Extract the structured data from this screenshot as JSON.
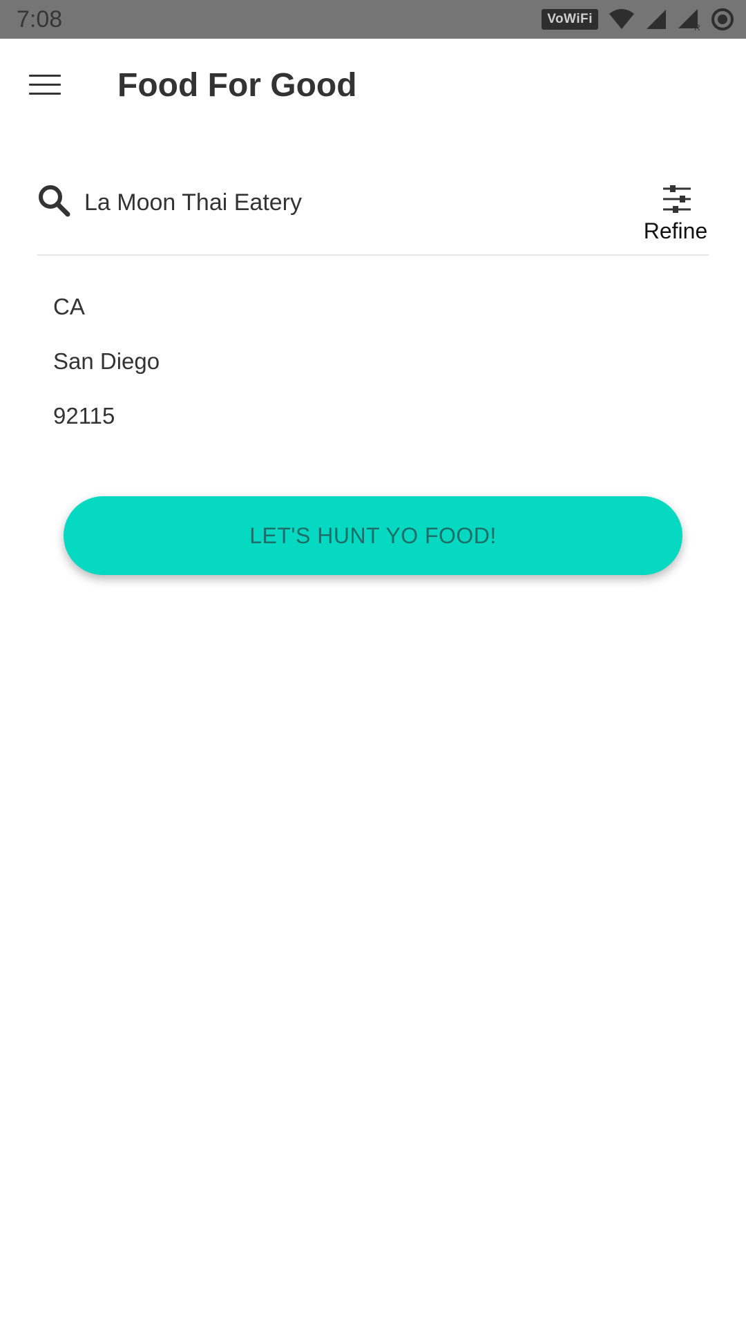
{
  "status_bar": {
    "time": "7:08",
    "vowifi_label": "VoWiFi",
    "icons": [
      "vowifi-icon",
      "wifi-icon",
      "cell-signal-icon",
      "cell-signal-roaming-icon",
      "sync-icon"
    ]
  },
  "app_bar": {
    "title": "Food For Good",
    "menu_icon": "menu-icon"
  },
  "search": {
    "value": "La Moon Thai Eatery",
    "icon": "search-icon",
    "refine_label": "Refine",
    "refine_icon": "sliders-icon"
  },
  "location": {
    "items": [
      {
        "label": "CA"
      },
      {
        "label": "San Diego"
      },
      {
        "label": "92115"
      }
    ]
  },
  "cta": {
    "label": "LET'S HUNT YO FOOD!"
  },
  "colors": {
    "accent": "#05d9c2",
    "accent_text": "#1d6e66",
    "status_bar": "#757575",
    "text": "#333333"
  }
}
